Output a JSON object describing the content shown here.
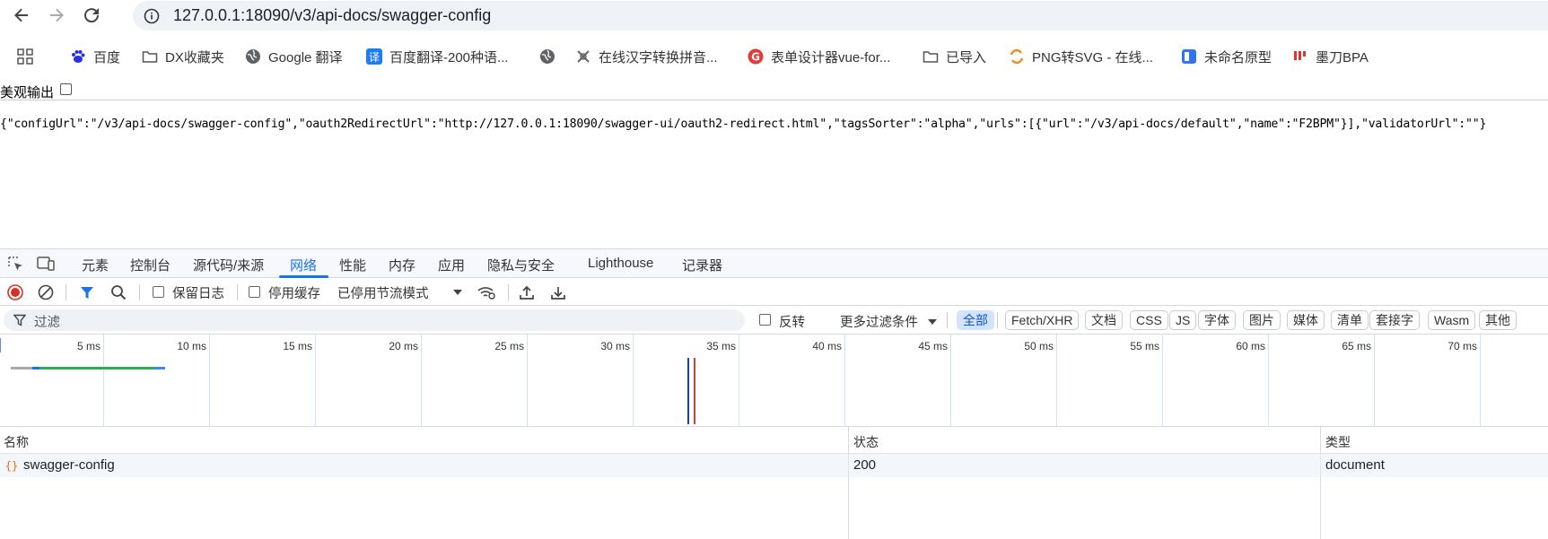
{
  "browser": {
    "url": "127.0.0.1:18090/v3/api-docs/swagger-config",
    "icons": [
      "back-icon",
      "forward-icon",
      "reload-icon",
      "site-info-icon"
    ]
  },
  "bookmarks": [
    {
      "label": "百度",
      "icon": "baidu-paw-icon"
    },
    {
      "label": "DX收藏夹",
      "icon": "folder-icon"
    },
    {
      "label": "Google 翻译",
      "icon": "globe-icon"
    },
    {
      "label": "百度翻译-200种语...",
      "icon": "baidu-translate-icon"
    },
    {
      "label": "",
      "icon": "globe-icon"
    },
    {
      "label": "在线汉字转换拼音...",
      "icon": "tool-icon"
    },
    {
      "label": "表单设计器vue-for...",
      "icon": "red-g-icon"
    },
    {
      "label": "已导入",
      "icon": "folder-icon"
    },
    {
      "label": "PNG转SVG - 在线...",
      "icon": "swap-icon"
    },
    {
      "label": "未命名原型",
      "icon": "prototype-icon"
    },
    {
      "label": "墨刀BPA",
      "icon": "modao-icon"
    }
  ],
  "viewer": {
    "pretty_print_label": "美观输出",
    "json_text": "{\"configUrl\":\"/v3/api-docs/swagger-config\",\"oauth2RedirectUrl\":\"http://127.0.0.1:18090/swagger-ui/oauth2-redirect.html\",\"tagsSorter\":\"alpha\",\"urls\":[{\"url\":\"/v3/api-docs/default\",\"name\":\"F2BPM\"}],\"validatorUrl\":\"\"}"
  },
  "devtools": {
    "tabs": [
      "元素",
      "控制台",
      "源代码/来源",
      "网络",
      "性能",
      "内存",
      "应用",
      "隐私与安全",
      "Lighthouse",
      "记录器"
    ],
    "active_tab": "网络",
    "toolbar": {
      "preserve_log": "保留日志",
      "disable_cache": "停用缓存",
      "throttling": "已停用节流模式"
    },
    "filter": {
      "placeholder": "过滤",
      "invert": "反转",
      "more_filters": "更多过滤条件",
      "chips": [
        "全部",
        "Fetch/XHR",
        "文档",
        "CSS",
        "JS",
        "字体",
        "图片",
        "媒体",
        "清单",
        "套接字",
        "Wasm",
        "其他"
      ]
    },
    "timeline_ticks": [
      "5 ms",
      "10 ms",
      "15 ms",
      "20 ms",
      "25 ms",
      "30 ms",
      "35 ms",
      "40 ms",
      "45 ms",
      "50 ms",
      "55 ms",
      "60 ms",
      "65 ms",
      "70 ms"
    ],
    "columns": [
      "名称",
      "状态",
      "类型"
    ],
    "rows": [
      {
        "name": "swagger-config",
        "status": "200",
        "type": "document"
      }
    ],
    "colors": {
      "accent": "#1a73e8",
      "record": "#d93025",
      "dom_line": "#1a3fb0",
      "load_line": "#e53935"
    }
  }
}
